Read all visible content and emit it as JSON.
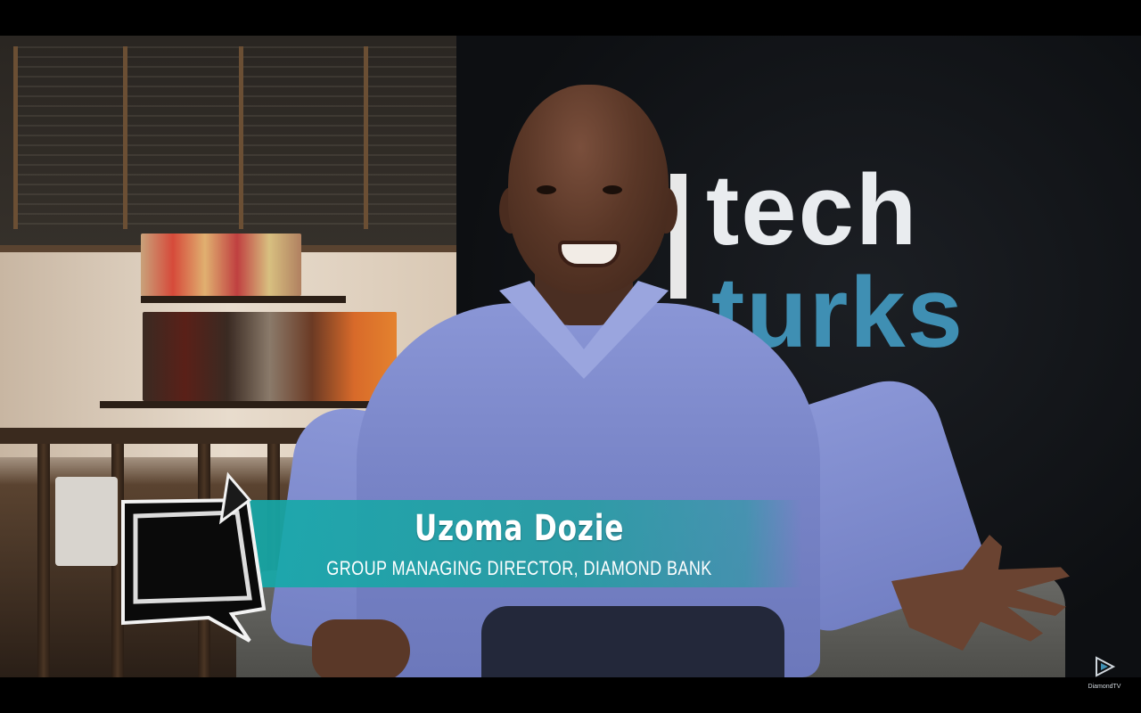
{
  "lower_third": {
    "name": "Uzoma Dozie",
    "title": "GROUP MANAGING DIRECTOR, DIAMOND BANK"
  },
  "backdrop_logo": {
    "line1": "tech",
    "line2": "turks"
  },
  "watermark": {
    "label": "DiamondTV",
    "icon": "play-triangle-icon"
  },
  "badge": {
    "icon": "speech-bubble-logo-icon"
  },
  "colors": {
    "lower_third_bg": "#14aaaa",
    "logo_tech": "#e9ecef",
    "logo_turks": "#3f8fb3",
    "shirt": "#8a96d6"
  }
}
